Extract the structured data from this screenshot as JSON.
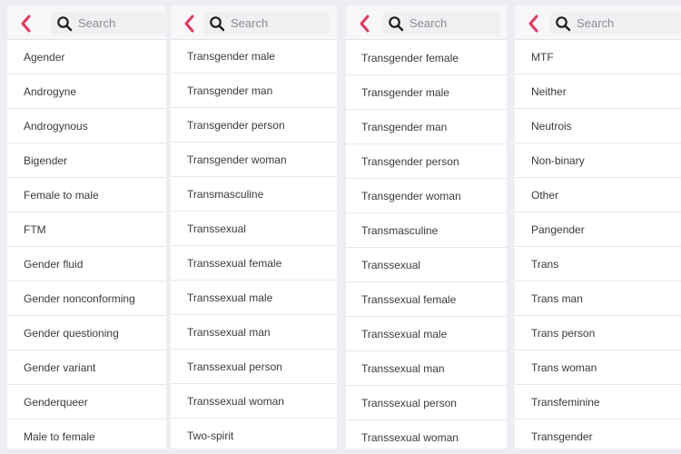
{
  "search": {
    "placeholder": "Search"
  },
  "panels": [
    {
      "items": [
        "Agender",
        "Androgyne",
        "Androgynous",
        "Bigender",
        "Female to male",
        "FTM",
        "Gender fluid",
        "Gender nonconforming",
        "Gender questioning",
        "Gender variant",
        "Genderqueer",
        "Male to female"
      ]
    },
    {
      "items": [
        "Transgender male",
        "Transgender man",
        "Transgender person",
        "Transgender woman",
        "Transmasculine",
        "Transsexual",
        "Transsexual female",
        "Transsexual male",
        "Transsexual man",
        "Transsexual person",
        "Transsexual woman",
        "Two-spirit"
      ]
    },
    {
      "items": [
        "Transgender female",
        "Transgender male",
        "Transgender man",
        "Transgender person",
        "Transgender woman",
        "Transmasculine",
        "Transsexual",
        "Transsexual female",
        "Transsexual male",
        "Transsexual man",
        "Transsexual person",
        "Transsexual woman"
      ]
    },
    {
      "items": [
        "MTF",
        "Neither",
        "Neutrois",
        "Non-binary",
        "Other",
        "Pangender",
        "Trans",
        "Trans man",
        "Trans person",
        "Trans woman",
        "Transfeminine",
        "Transgender"
      ]
    }
  ],
  "colors": {
    "accent": "#e8355b",
    "text": "#3a3a3f",
    "divider": "#e7e7ea"
  },
  "icons": {
    "back": "chevron-left-icon",
    "search": "search-icon"
  }
}
